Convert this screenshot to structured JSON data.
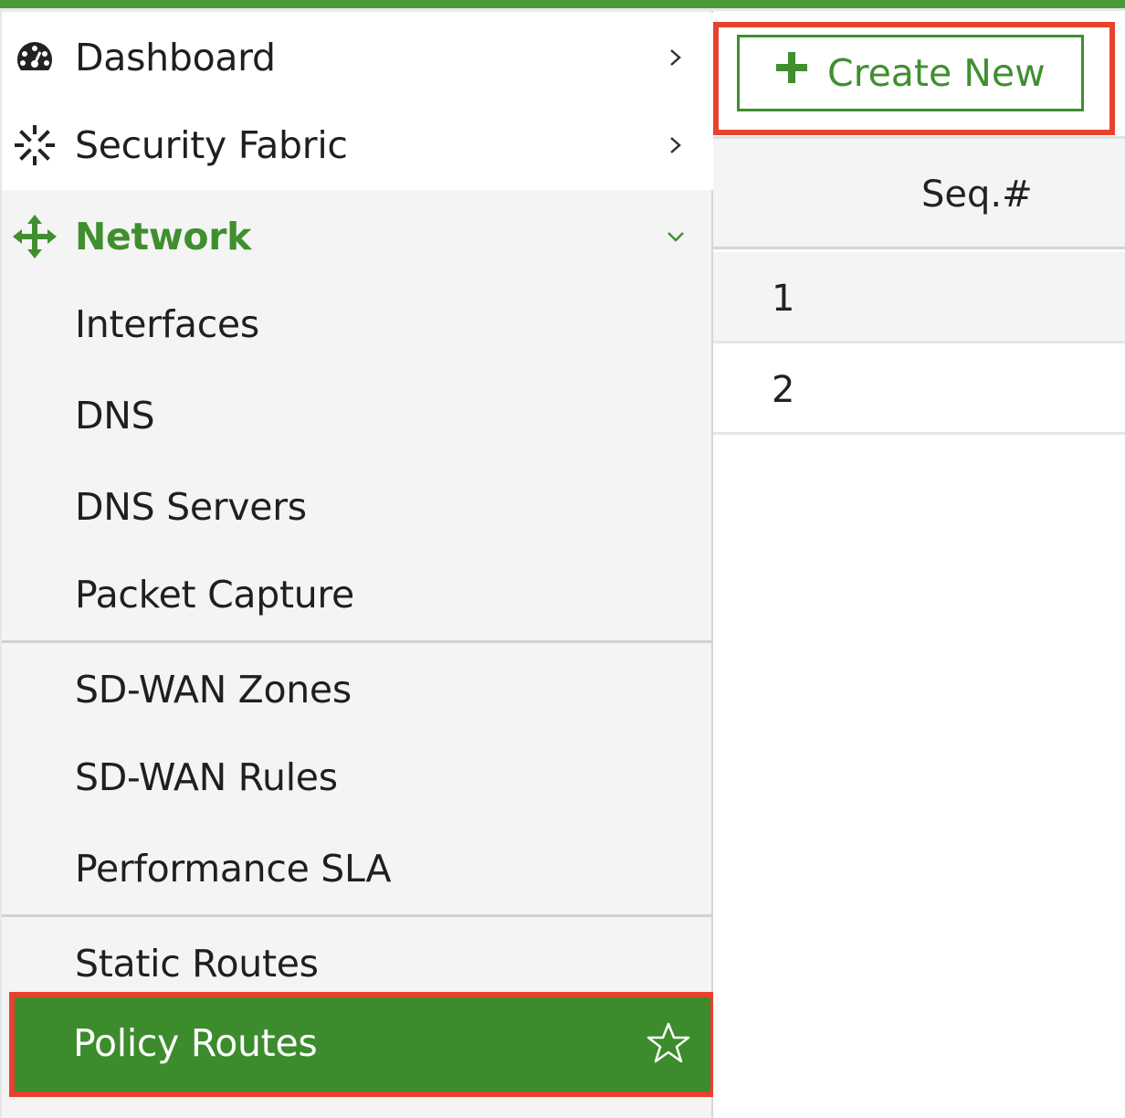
{
  "sidebar": {
    "items": [
      {
        "label": "Dashboard"
      },
      {
        "label": "Security Fabric"
      },
      {
        "label": "Network"
      },
      {
        "label": "Interfaces"
      },
      {
        "label": "DNS"
      },
      {
        "label": "DNS Servers"
      },
      {
        "label": "Packet Capture"
      },
      {
        "label": "SD-WAN Zones"
      },
      {
        "label": "SD-WAN Rules"
      },
      {
        "label": "Performance SLA"
      },
      {
        "label": "Static Routes"
      },
      {
        "label": "Policy Routes"
      }
    ]
  },
  "toolbar": {
    "create_label": "Create New"
  },
  "table": {
    "columns": [
      "Seq.#"
    ],
    "rows": [
      {
        "seq": "1"
      },
      {
        "seq": "2"
      }
    ]
  },
  "colors": {
    "brand_green": "#3f8f2f",
    "highlight_red": "#e8412f",
    "sidebar_bg": "#f4f4f4"
  },
  "icons": {
    "dashboard": "dashboard-gauge-icon",
    "security_fabric": "security-fabric-icon",
    "network": "network-move-icon",
    "chevron_right": "chevron-right-icon",
    "chevron_down": "chevron-down-icon",
    "star": "star-outline-icon",
    "plus": "plus-icon"
  }
}
